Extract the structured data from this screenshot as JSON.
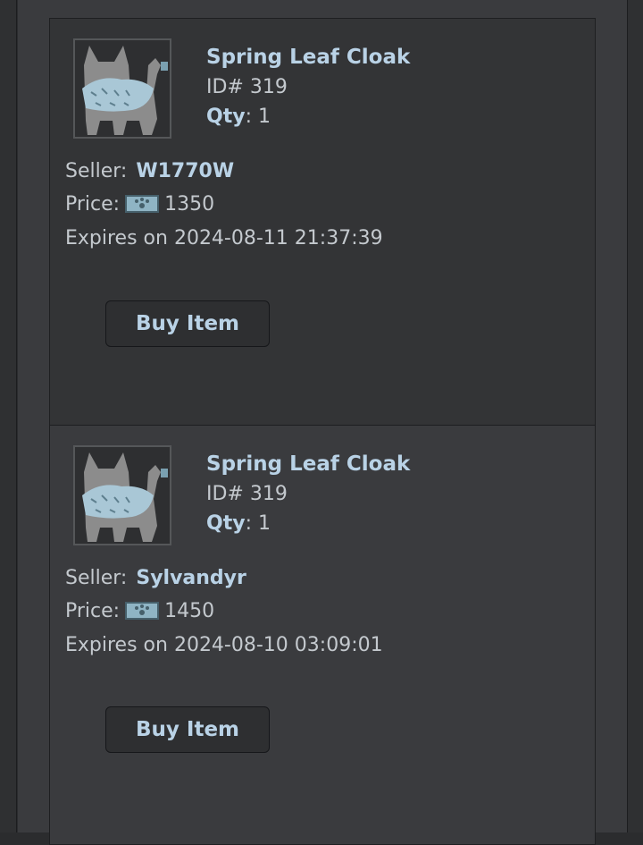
{
  "listings": [
    {
      "item_name": "Spring Leaf Cloak",
      "item_id": "ID# 319",
      "qty_label": "Qty",
      "qty_value": ": 1",
      "seller_label": "Seller:",
      "seller_name": "W1770W",
      "price_label": "Price:",
      "price_value": "1350",
      "expires": "Expires on 2024-08-11 21:37:39",
      "buy_label": "Buy Item",
      "thumb_icon": "cat-cloak-icon",
      "currency_icon": "paw-currency-icon"
    },
    {
      "item_name": "Spring Leaf Cloak",
      "item_id": "ID# 319",
      "qty_label": "Qty",
      "qty_value": ": 1",
      "seller_label": "Seller:",
      "seller_name": "Sylvandyr",
      "price_label": "Price:",
      "price_value": "1450",
      "expires": "Expires on 2024-08-10 03:09:01",
      "buy_label": "Buy Item",
      "thumb_icon": "cat-cloak-icon",
      "currency_icon": "paw-currency-icon"
    }
  ],
  "colors": {
    "accent_text": "#b9d2e6",
    "body_text": "#c4c9ce",
    "panel_bg": "#3a3b3e"
  }
}
